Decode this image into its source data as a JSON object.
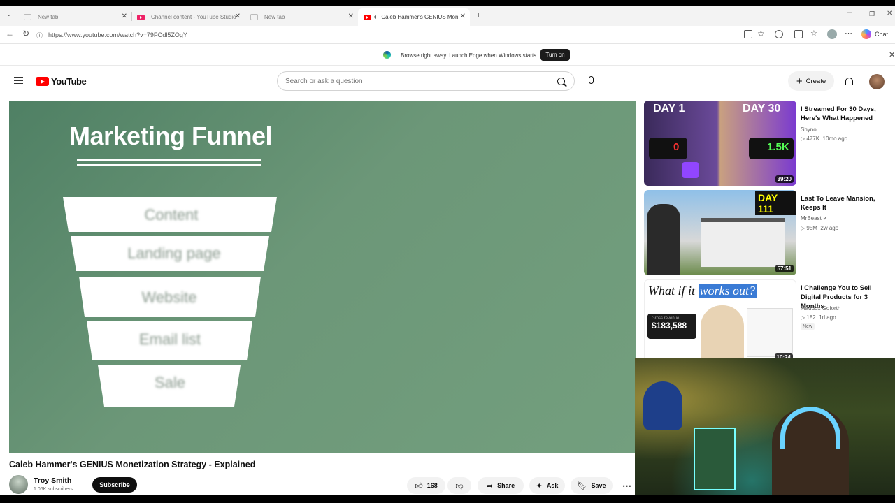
{
  "browser": {
    "tabs": [
      {
        "title": "New tab",
        "active": false
      },
      {
        "title": "Channel content - YouTube Studio",
        "active": false
      },
      {
        "title": "New tab",
        "active": false
      },
      {
        "title": "Caleb Hammer's GENIUS Mon",
        "active": true
      }
    ],
    "url": "https://www.youtube.com/watch?v=79FOdl5ZOgY",
    "chat_label": "Chat",
    "infobar": {
      "text": "Browse right away. Launch Edge when Windows starts.",
      "button": "Turn on"
    }
  },
  "youtube": {
    "logo_text": "YouTube",
    "search_placeholder": "Search or ask a question",
    "create_label": "Create"
  },
  "video": {
    "slide_title": "Marketing Funnel",
    "funnel_labels": [
      "Content",
      "Landing page",
      "Website",
      "Email list",
      "Sale"
    ],
    "title": "Caleb Hammer's GENIUS Monetization Strategy - Explained",
    "channel": "Troy Smith",
    "subscribers": "1.06K subscribers",
    "subscribe_label": "Subscribe",
    "likes": "168",
    "share_label": "Share",
    "ask_label": "Ask",
    "save_label": "Save"
  },
  "recommendations": [
    {
      "title": "I Streamed For 30 Days, Here's What Happened",
      "channel": "Shyno",
      "views": "477K",
      "age": "10mo ago",
      "duration": "39:20",
      "thumb_day_left": "DAY 1",
      "thumb_day_right": "DAY 30",
      "thumb_count_left": "0",
      "thumb_count_right": "1.5K"
    },
    {
      "title": "Last To Leave Mansion, Keeps It",
      "channel": "MrBeast",
      "verified": true,
      "views": "95M",
      "age": "2w ago",
      "duration": "57:51",
      "thumb_text": "DAY 111"
    },
    {
      "title": "I Challenge You to Sell Digital Products for 3 Months",
      "channel": "Maddox Goforth",
      "views": "182",
      "age": "1d ago",
      "badge": "New",
      "duration": "10:24",
      "thumb_headline_a": "What if it ",
      "thumb_headline_b": "works out?",
      "thumb_revenue_label": "Gross revenue",
      "thumb_revenue": "$183,588"
    }
  ]
}
